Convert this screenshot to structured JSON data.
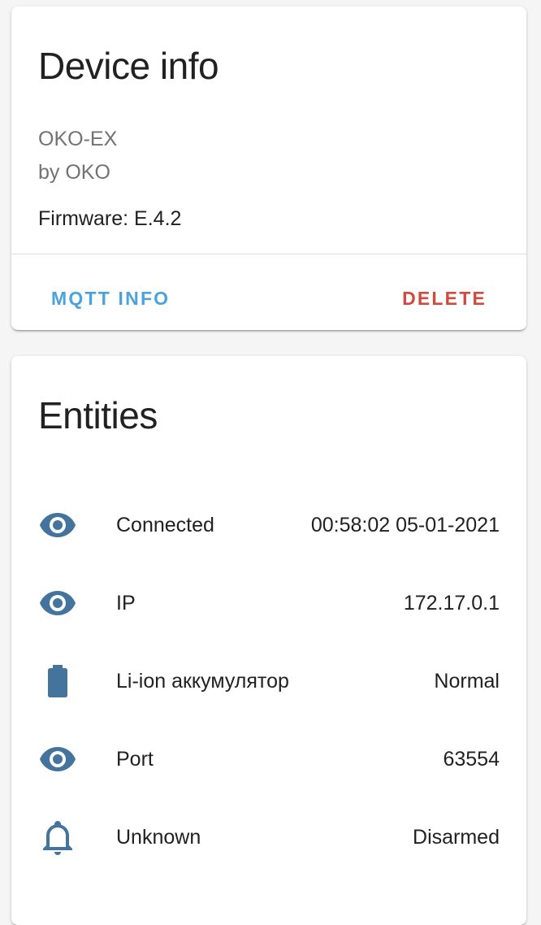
{
  "device_card": {
    "title": "Device info",
    "model": "OKO-EX",
    "manufacturer": "by OKO",
    "firmware": "Firmware: E.4.2",
    "actions": {
      "mqtt_label": "MQTT INFO",
      "delete_label": "DELETE"
    }
  },
  "entities_card": {
    "title": "Entities",
    "rows": [
      {
        "icon": "eye-icon",
        "name": "Connected",
        "state": "00:58:02 05-01-2021"
      },
      {
        "icon": "eye-icon",
        "name": "IP",
        "state": "172.17.0.1"
      },
      {
        "icon": "battery-icon",
        "name": "Li-ion аккумулятор",
        "state": "Normal"
      },
      {
        "icon": "eye-icon",
        "name": "Port",
        "state": "63554"
      },
      {
        "icon": "bell-icon",
        "name": "Unknown",
        "state": "Disarmed"
      }
    ]
  },
  "colors": {
    "primary_button": "#4aa3df",
    "destructive_button": "#d04b3d",
    "icon": "#44739e",
    "secondary_text": "#727272",
    "primary_text": "#212121"
  }
}
